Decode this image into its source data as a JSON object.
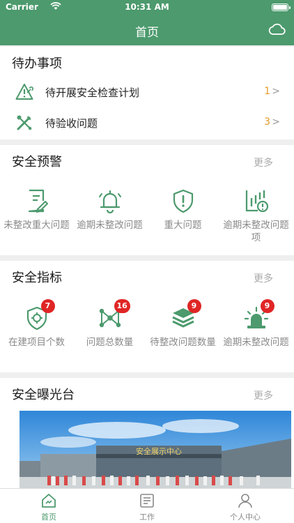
{
  "status_bar": {
    "carrier": "Carrier",
    "time": "10:31 AM"
  },
  "nav": {
    "title": "首页",
    "right_icon": "cloud-icon"
  },
  "todo": {
    "title": "待办事项",
    "items": [
      {
        "label": "待开展安全检查计划",
        "count": "1",
        "icon": "alert-wrench-icon"
      },
      {
        "label": "待验收问题",
        "count": "3",
        "icon": "tools-icon"
      }
    ]
  },
  "warning": {
    "title": "安全预警",
    "more": "更多",
    "items": [
      {
        "label": "未整改重大问题",
        "icon": "document-edit-icon"
      },
      {
        "label": "逾期未整改问题",
        "icon": "bell-icon"
      },
      {
        "label": "重大问题",
        "icon": "shield-alert-icon"
      },
      {
        "label": "逾期未整改问题项",
        "icon": "chart-alert-icon"
      }
    ]
  },
  "indicators": {
    "title": "安全指标",
    "more": "更多",
    "items": [
      {
        "label": "在建项目个数",
        "badge": "7",
        "icon": "shield-target-icon"
      },
      {
        "label": "问题总数量",
        "badge": "16",
        "icon": "network-icon"
      },
      {
        "label": "待整改问题数量",
        "badge": "9",
        "icon": "layers-icon"
      },
      {
        "label": "逾期未整改问题",
        "badge": "9",
        "icon": "siren-icon"
      }
    ]
  },
  "exposure": {
    "title": "安全曝光台",
    "more": "更多",
    "photo_caption": "安全展示中心"
  },
  "tabs": [
    {
      "label": "首页",
      "icon": "home-icon",
      "active": true
    },
    {
      "label": "工作",
      "icon": "list-icon",
      "active": false
    },
    {
      "label": "个人中心",
      "icon": "person-icon",
      "active": false
    }
  ],
  "colors": {
    "primary": "#4c9a6d",
    "count": "#e59a2a",
    "badge": "#e02525",
    "muted": "#8a8a8a"
  }
}
